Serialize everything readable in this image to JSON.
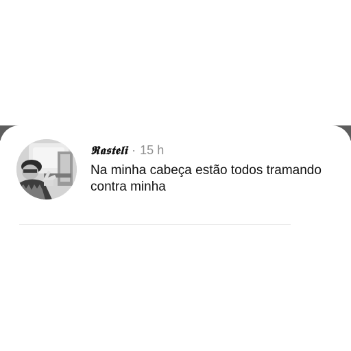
{
  "comment": {
    "username": "𝕽𝖆𝖘𝖙𝖊𝖑𝖎",
    "separator": "·",
    "time": "15 h",
    "text": "Na minha cabeça estão todos tramando contra minha"
  },
  "avatar": {
    "icon": "profile-photo"
  },
  "colors": {
    "primary_text": "#111111",
    "secondary_text": "#8e8e8e",
    "divider": "#ececec",
    "background": "#ffffff"
  }
}
